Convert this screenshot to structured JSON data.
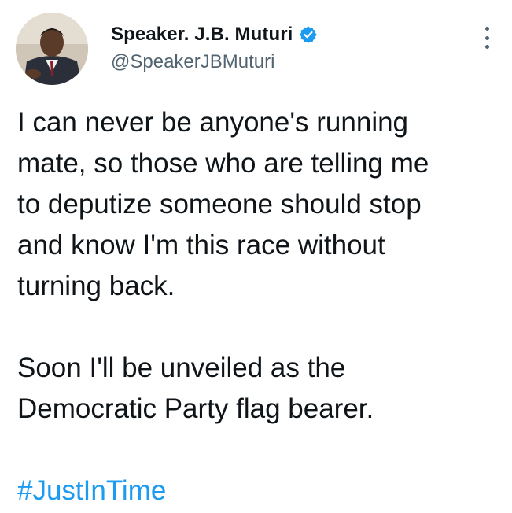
{
  "author": {
    "display_name": "Speaker. J.B. Muturi",
    "handle": "@SpeakerJBMuturi",
    "verified": true
  },
  "tweet": {
    "lines_para1": [
      "I can never be anyone's running",
      "mate, so those who are telling me",
      "to deputize someone should stop",
      "and know I'm this race without",
      "turning back."
    ],
    "lines_para2": [
      "Soon I'll be unveiled as the",
      "Democratic Party flag bearer."
    ],
    "hashtag": "#JustInTime"
  },
  "colors": {
    "text": "#0f1419",
    "secondary": "#536471",
    "link": "#1d9bf0",
    "verified_badge": "#1d9bf0"
  },
  "icons": {
    "verified": "verified-badge-icon",
    "more": "more-options-icon"
  }
}
